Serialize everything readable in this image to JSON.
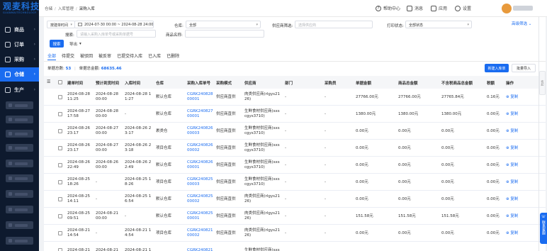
{
  "brand": {
    "logo_text": "观麦科技",
    "logo_sub": "GUANMAITECHNOLOGY"
  },
  "sidebar": {
    "items": [
      {
        "label": "商品",
        "icon": "grid-icon",
        "active": false
      },
      {
        "label": "订单",
        "icon": "order-icon",
        "active": false
      },
      {
        "label": "采购",
        "icon": "cart-icon",
        "active": false
      },
      {
        "label": "仓储",
        "icon": "warehouse-icon",
        "active": true
      },
      {
        "label": "生产",
        "icon": "factory-icon",
        "active": false
      }
    ]
  },
  "breadcrumb": {
    "items": [
      "仓储",
      "入库管理",
      "采购入库"
    ]
  },
  "topbar": {
    "help": "帮助中心",
    "messages": "消息",
    "apps": "应用",
    "settings": "设置"
  },
  "filters": {
    "date_type": "按建单时间",
    "date_range": "2024-07-30 00:00 ~ 2024-08-28 24:00",
    "warehouse_label": "仓库:",
    "warehouse_value": "全部",
    "supplier_label": "供应商筛选:",
    "supplier_placeholder": "选择供应商",
    "print_label": "打印状态:",
    "print_value": "全部状态",
    "expand": "高级筛选",
    "search_label": "搜索:",
    "search_placeholder": "请输入采购入库单号或采购单据号",
    "product_label": "商品名称:",
    "search_button": "搜索",
    "export_button": "导出"
  },
  "tabs": [
    {
      "label": "全部",
      "active": true
    },
    {
      "label": "待提交",
      "active": false
    },
    {
      "label": "被驳回",
      "active": false
    },
    {
      "label": "被反审",
      "active": false
    },
    {
      "label": "已提交待入库",
      "active": false
    },
    {
      "label": "已入库",
      "active": false
    },
    {
      "label": "已删除",
      "active": false
    }
  ],
  "summary": {
    "count_label": "单据总数:",
    "count": "53",
    "amount_label": "单据总金额:",
    "amount": "68635.46"
  },
  "actions": {
    "new": "新建入库单",
    "import": "批量导入"
  },
  "table": {
    "headers": [
      "建单时间",
      "预计到货时间",
      "入库时间",
      "仓库",
      "采购入库单号",
      "采购模式",
      "供应商",
      "部门",
      "采购员",
      "单据金额",
      "商品总金额",
      "不含税商品总金额",
      "税额",
      "操作"
    ],
    "rows": [
      {
        "created": [
          "2024-08-28",
          "11:25"
        ],
        "eta": [
          "2024-08-28",
          "00:00"
        ],
        "stock_in": [
          "2024-08-28 1",
          "1:27"
        ],
        "warehouse": "默认仓库",
        "order_no": [
          "CGRK240828",
          "00001"
        ],
        "mode": "供应商直供",
        "supplier": [
          "肉类供应商(rlgys21",
          "26)"
        ],
        "dept": "-",
        "buyer": "-",
        "amount": "27766.00元",
        "goods": "27766.00元",
        "notax": "27765.84元",
        "tax": "0.16元",
        "op": "复制"
      },
      {
        "created": [
          "2024-08-27",
          "17:58"
        ],
        "eta": [
          "2024-08-28",
          "00:00"
        ],
        "stock_in": [
          "-"
        ],
        "warehouse": "默认仓库",
        "order_no": [
          "CGRK240827",
          "00001"
        ],
        "mode": "供应商直供",
        "supplier": [
          "生鲜食材供应商(sxs",
          "cgys3710)"
        ],
        "dept": "-",
        "buyer": "-",
        "amount": "1380.00元",
        "goods": "1380.00元",
        "notax": "1380.00元",
        "tax": "0.00元",
        "op": "复制"
      },
      {
        "created": [
          "2024-08-26",
          "23:17"
        ],
        "eta": [
          "2024-08-27",
          "00:00"
        ],
        "stock_in": [
          "2024-08-26 2",
          "3:17"
        ],
        "warehouse": "裹类仓",
        "order_no": [
          "CGRK240826",
          "00003"
        ],
        "mode": "供应商直供",
        "supplier": [
          "生鲜食材供应商(sxs",
          "cgys3710)"
        ],
        "dept": "-",
        "buyer": "-",
        "amount": "0.00元",
        "goods": "0.00元",
        "notax": "0.00元",
        "tax": "0.00元",
        "op": "复制"
      },
      {
        "created": [
          "2024-08-26",
          "23:17"
        ],
        "eta": [
          "2024-08-27",
          "00:00"
        ],
        "stock_in": [
          "2024-08-26 2",
          "3:18"
        ],
        "warehouse": "项目仓库",
        "order_no": [
          "CGRK240826",
          "00002"
        ],
        "mode": "供应商直供",
        "supplier": [
          "生鲜食材供应商(sxs",
          "cgys3710)"
        ],
        "dept": "-",
        "buyer": "-",
        "amount": "0.00元",
        "goods": "0.00元",
        "notax": "0.00元",
        "tax": "0.00元",
        "op": "复制"
      },
      {
        "created": [
          "2024-08-26",
          "22:49"
        ],
        "eta": [
          "2024-08-26",
          "00:00"
        ],
        "stock_in": [
          "2024-08-26 2",
          "2:49"
        ],
        "warehouse": "默认仓库",
        "order_no": [
          "CGRK240826",
          "00001"
        ],
        "mode": "供应商直供",
        "supplier": [
          "生鲜食材供应商(sxs",
          "cgys3710)"
        ],
        "dept": "-",
        "buyer": "-",
        "amount": "0.00元",
        "goods": "0.00元",
        "notax": "0.00元",
        "tax": "0.00元",
        "op": "复制"
      },
      {
        "created": [
          "2024-08-25",
          "18:26"
        ],
        "eta": [
          "-"
        ],
        "stock_in": [
          "2024-08-25 1",
          "8:26"
        ],
        "warehouse": "项目仓库",
        "order_no": [
          "CGRK240825",
          "00003"
        ],
        "mode": "供应商直供",
        "supplier": [
          "生鲜食材供应商(sxs",
          "cgys3710)"
        ],
        "dept": "-",
        "buyer": "-",
        "amount": "0.00元",
        "goods": "0.00元",
        "notax": "0.00元",
        "tax": "0.00元",
        "op": "复制"
      },
      {
        "created": [
          "2024-08-25",
          "14:11"
        ],
        "eta": [
          "-"
        ],
        "stock_in": [
          "2024-08-25 1",
          "6:54"
        ],
        "warehouse": "默认仓库",
        "order_no": [
          "CGRK240825",
          "00002"
        ],
        "mode": "供应商直供",
        "supplier": [
          "肉类供应商(rlgys21",
          "26)"
        ],
        "dept": "-",
        "buyer": "-",
        "amount": "0.00元",
        "goods": "0.00元",
        "notax": "0.00元",
        "tax": "0.00元",
        "op": "复制"
      },
      {
        "created": [
          "2024-08-25",
          "09:51"
        ],
        "eta": [
          "2024-08-21",
          "00:00"
        ],
        "stock_in": [
          "-"
        ],
        "warehouse": "默认仓库",
        "order_no": [
          "CGRK240825",
          "00001"
        ],
        "mode": "供应商直供",
        "supplier": [
          "肉类供应商(rlgys21",
          "26)"
        ],
        "dept": "-",
        "buyer": "-",
        "amount": "151.58元",
        "goods": "151.58元",
        "notax": "151.58元",
        "tax": "0.00元",
        "op": "复制"
      },
      {
        "created": [
          "2024-08-21",
          "14:54"
        ],
        "eta": [
          "-"
        ],
        "stock_in": [
          "2024-08-21 1",
          "4:54"
        ],
        "warehouse": "项目仓库",
        "order_no": [
          "CGRK240821",
          "00002"
        ],
        "mode": "供应商直供",
        "supplier": [
          "肉类供应商(rlgys21",
          "26)"
        ],
        "dept": "-",
        "buyer": "-",
        "amount": "0.00元",
        "goods": "0.00元",
        "notax": "0.00元",
        "tax": "0.00元",
        "op": "复制"
      },
      {
        "created": [
          "2024-08-21",
          ""
        ],
        "eta": [
          "2024-08-21",
          ""
        ],
        "stock_in": [
          "2024-08-21 1",
          ""
        ],
        "warehouse": "",
        "order_no": [
          "CGRK240821",
          ""
        ],
        "mode": "",
        "supplier": [
          "生鲜食材供应商(sxs",
          ""
        ],
        "dept": "",
        "buyer": "",
        "amount": "",
        "goods": "",
        "notax": "",
        "tax": "",
        "op": ""
      }
    ]
  },
  "floating": {
    "label": "联系客服"
  },
  "scroll_tab": "收起"
}
